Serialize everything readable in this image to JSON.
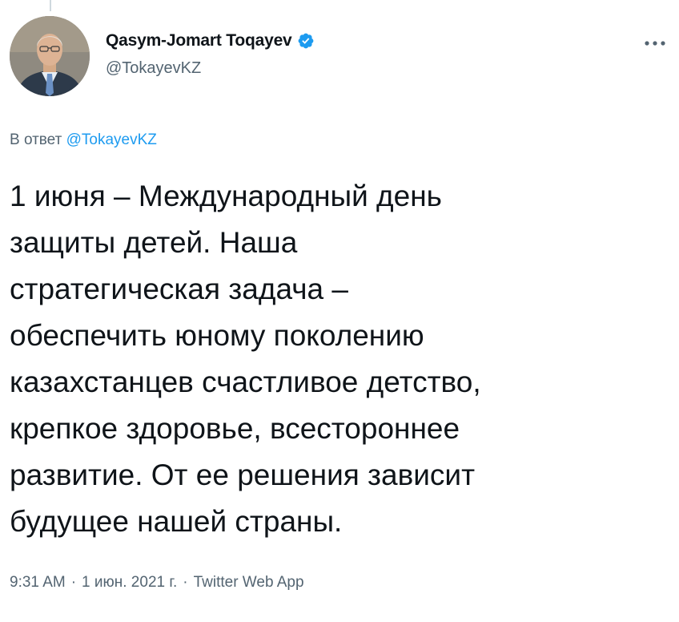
{
  "tweet": {
    "author": {
      "display_name": "Qasym-Jomart Toqayev",
      "handle": "@TokayevKZ",
      "verified": true
    },
    "reply_to": {
      "prefix": "В ответ",
      "mention": "@TokayevKZ"
    },
    "text": "1 июня – Международный день\nзащиты детей. Наша\nстратегическая задача –\nобеспечить юному поколению\nказахстанцев счастливое детство,\nкрепкое здоровье, всестороннее\nразвитие. От ее решения зависит\nбудущее нашей страны.",
    "time": "9:31 AM",
    "date": "1 июн. 2021 г.",
    "separator": "·",
    "source": "Twitter Web App"
  },
  "icons": {
    "verified": "verified-badge-icon",
    "more": "more-horizontal-icon"
  },
  "colors": {
    "accent": "#1d9bf0",
    "secondary_text": "#536471",
    "primary_text": "#0f1419"
  }
}
